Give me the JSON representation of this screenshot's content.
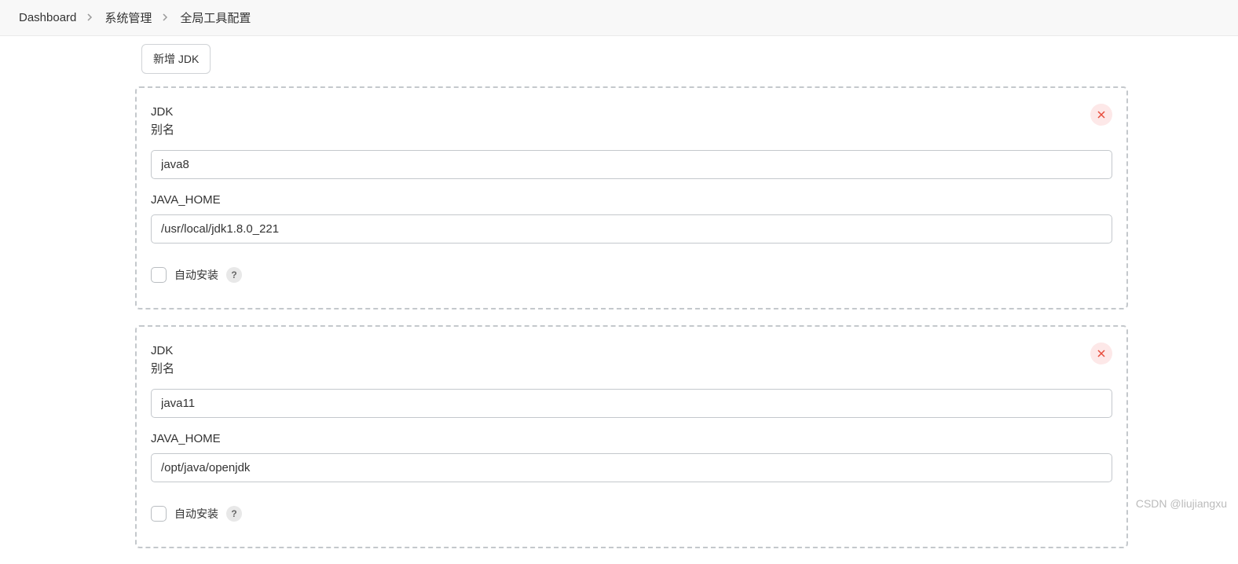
{
  "breadcrumb": {
    "items": [
      "Dashboard",
      "系统管理",
      "全局工具配置"
    ]
  },
  "toolbar": {
    "add_jdk_label": "新增 JDK"
  },
  "jdk_section": {
    "block_title_line1": "JDK",
    "alias_label": "别名",
    "java_home_label": "JAVA_HOME",
    "auto_install_label": "自动安装",
    "help_symbol": "?"
  },
  "jdk_entries": [
    {
      "alias": "java8",
      "java_home": "/usr/local/jdk1.8.0_221",
      "auto_install": false
    },
    {
      "alias": "java11",
      "java_home": "/opt/java/openjdk",
      "auto_install": false
    }
  ],
  "watermark": "CSDN @liujiangxu"
}
